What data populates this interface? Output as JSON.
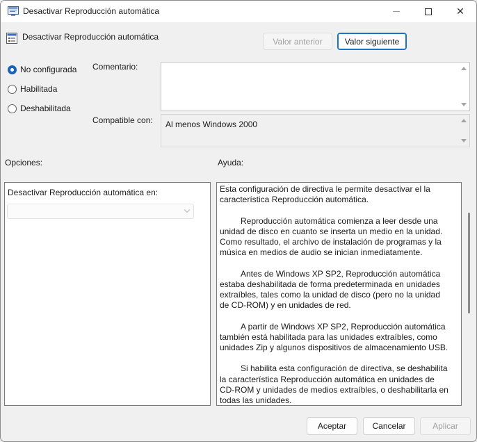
{
  "window": {
    "title": "Desactivar Reproducción automática",
    "controls": {
      "minimize": "minimize-icon",
      "maximize": "maximize-icon",
      "close": "✕"
    }
  },
  "header": {
    "policy_title": "Desactivar Reproducción automática",
    "prev_label": "Valor anterior",
    "next_label": "Valor siguiente"
  },
  "state": {
    "options": [
      {
        "label": "No configurada",
        "checked": true
      },
      {
        "label": "Habilitada",
        "checked": false
      },
      {
        "label": "Deshabilitada",
        "checked": false
      }
    ]
  },
  "comment": {
    "label": "Comentario:",
    "value": ""
  },
  "compat": {
    "label": "Compatible con:",
    "value": "Al menos Windows 2000"
  },
  "sections": {
    "options_label": "Opciones:",
    "help_label": "Ayuda:"
  },
  "options_panel": {
    "field_label": "Desactivar Reproducción automática en:",
    "combo_value": ""
  },
  "help": {
    "paragraphs": [
      "Esta configuración de directiva le permite desactivar el la característica Reproducción automática.",
      "Reproducción automática comienza a leer desde una unidad de disco en cuanto se inserta un medio en la unidad. Como resultado, el archivo de instalación de programas y la música en medios de audio se inician inmediatamente.",
      "Antes de Windows XP SP2, Reproducción automática estaba deshabilitada de forma predeterminada en unidades extraíbles, tales como la unidad de disco (pero no la unidad de CD-ROM) y en unidades de red.",
      "A partir de Windows XP SP2, Reproducción automática también está habilitada para las unidades extraíbles, como unidades Zip y algunos dispositivos de almacenamiento USB.",
      "Si habilita esta configuración de directiva, se deshabilita la característica Reproducción automática en unidades de CD-ROM y unidades de medios extraíbles, o deshabilitarla en todas las unidades."
    ]
  },
  "footer": {
    "accept_label": "Aceptar",
    "cancel_label": "Cancelar",
    "apply_label": "Aplicar"
  },
  "colors": {
    "accent": "#1a62b8",
    "window_bg": "#f0f0f0"
  }
}
